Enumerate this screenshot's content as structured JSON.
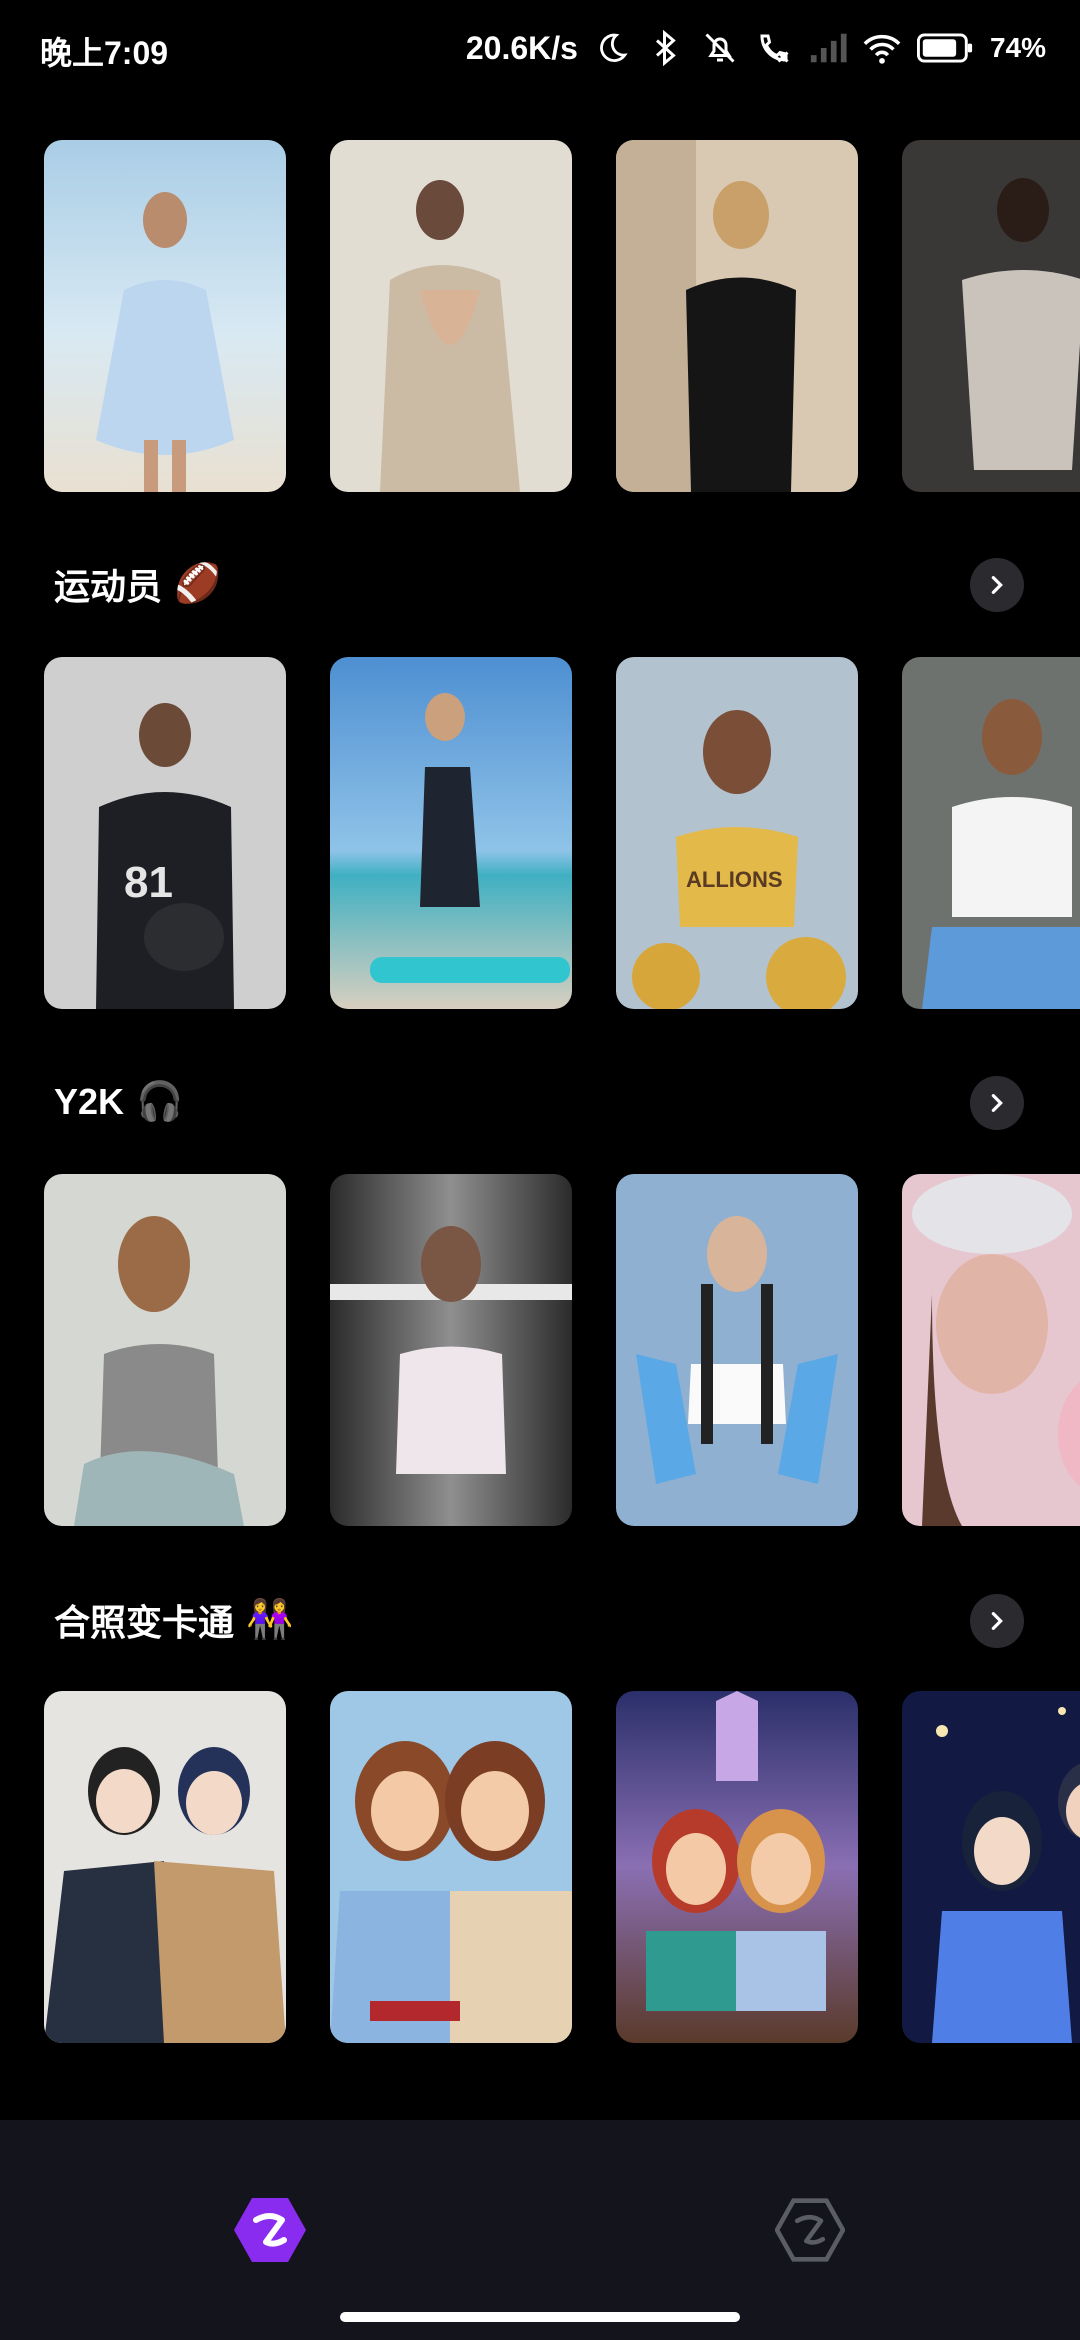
{
  "status_bar": {
    "time": "晚上7:09",
    "net_speed": "20.6K/s",
    "battery": "74%"
  },
  "sections": [
    {
      "title": "",
      "emoji": ""
    },
    {
      "title": "运动员",
      "emoji": "🏈"
    },
    {
      "title": "Y2K",
      "emoji": "🎧"
    },
    {
      "title": "合照变卡通",
      "emoji": "👭"
    }
  ],
  "colors": {
    "accent": "#7B2FF7",
    "background": "#000000",
    "nav_background": "#14151C"
  },
  "icons": {
    "nav_home": "app-logo-icon",
    "nav_other": "help-hexagon-icon",
    "more": "chevron-right-icon"
  }
}
